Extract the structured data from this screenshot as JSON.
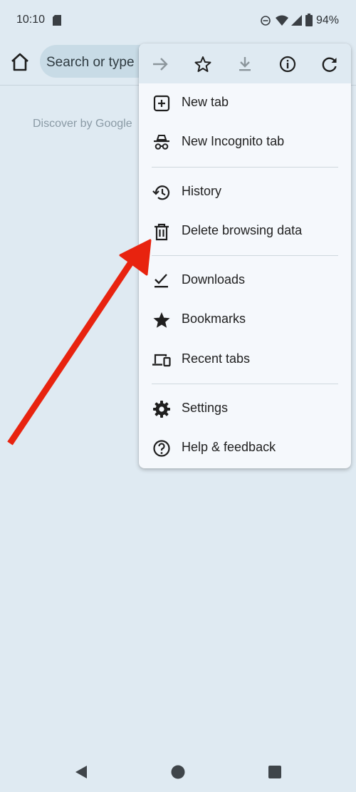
{
  "status_bar": {
    "time": "10:10",
    "battery": "94%",
    "icons": [
      "sd-card-icon",
      "do-not-disturb-icon",
      "wifi-icon",
      "cell-signal-icon",
      "battery-icon"
    ]
  },
  "toolbar": {
    "home_icon": "home-icon",
    "omnibox_placeholder": "Search or type"
  },
  "page": {
    "discover_label": "Discover by Google"
  },
  "menu": {
    "top_actions": [
      {
        "name": "forward",
        "icon": "arrow-right-icon"
      },
      {
        "name": "bookmark",
        "icon": "star-outline-icon"
      },
      {
        "name": "download",
        "icon": "download-icon"
      },
      {
        "name": "page-info",
        "icon": "info-icon"
      },
      {
        "name": "reload",
        "icon": "reload-icon"
      }
    ],
    "items": [
      {
        "label": "New tab",
        "icon": "new-tab-icon"
      },
      {
        "label": "New Incognito tab",
        "icon": "incognito-icon"
      },
      {
        "label": "History",
        "icon": "history-icon"
      },
      {
        "label": "Delete browsing data",
        "icon": "trash-icon"
      },
      {
        "label": "Downloads",
        "icon": "downloads-check-icon"
      },
      {
        "label": "Bookmarks",
        "icon": "star-filled-icon"
      },
      {
        "label": "Recent tabs",
        "icon": "devices-icon"
      },
      {
        "label": "Settings",
        "icon": "gear-icon"
      },
      {
        "label": "Help & feedback",
        "icon": "help-icon"
      }
    ]
  },
  "annotation": {
    "arrow_color": "#e8230f",
    "points_to": "Delete browsing data"
  },
  "nav_bar": {
    "icons": [
      "back-triangle-icon",
      "home-circle-icon",
      "recents-square-icon"
    ]
  },
  "colors": {
    "background": "#dfeaf2",
    "menu_background": "#f5f8fc",
    "omnibox": "#c8dbe6"
  }
}
